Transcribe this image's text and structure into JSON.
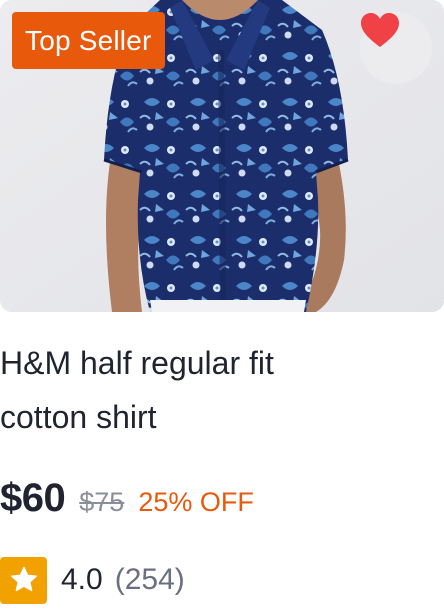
{
  "product": {
    "badge": "Top Seller",
    "title_line1": "H&M half regular fit",
    "title_line2": "cotton shirt",
    "price": "$60",
    "original_price": "$75",
    "discount": "25% OFF",
    "rating": "4.0",
    "reviews": "(254)",
    "favorited": true
  },
  "icons": {
    "favorite": "heart-icon",
    "rating": "star-icon"
  },
  "colors": {
    "badge": "#e8590c",
    "heart": "#ef4146",
    "star_box": "#f2a200",
    "discount": "#e8590c",
    "shirt": "#1c2d6b"
  }
}
